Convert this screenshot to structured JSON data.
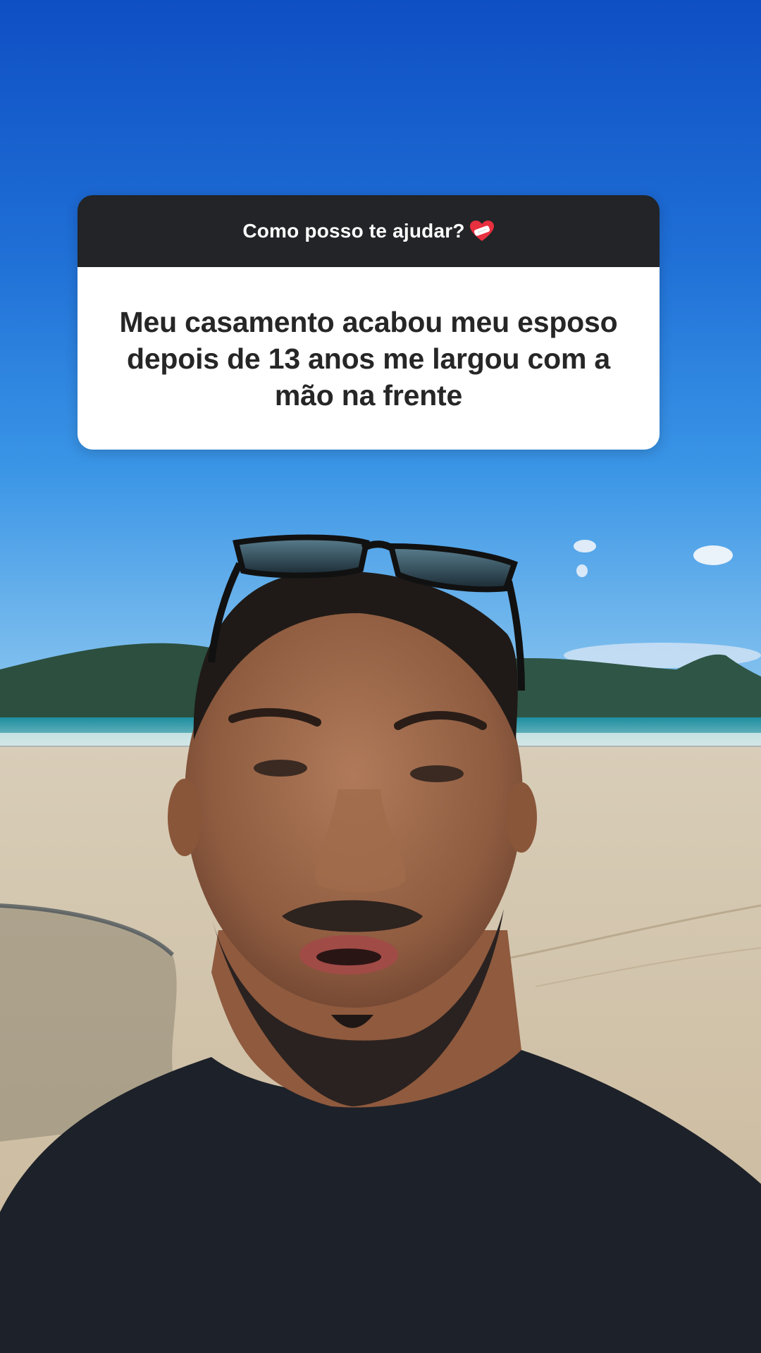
{
  "question_sticker": {
    "prompt": "Como posso te ajudar?",
    "prompt_emoji_icon": "mending-heart-icon",
    "answer": "Meu casamento acabou meu esposo depois de 13 anos me largou com a mão na frente"
  },
  "background": {
    "description_icon": "beach-selfie-photo",
    "sky_color": "#1f6fd6",
    "sand_color": "#d9cbb0",
    "shirt_color": "#1d2129"
  }
}
